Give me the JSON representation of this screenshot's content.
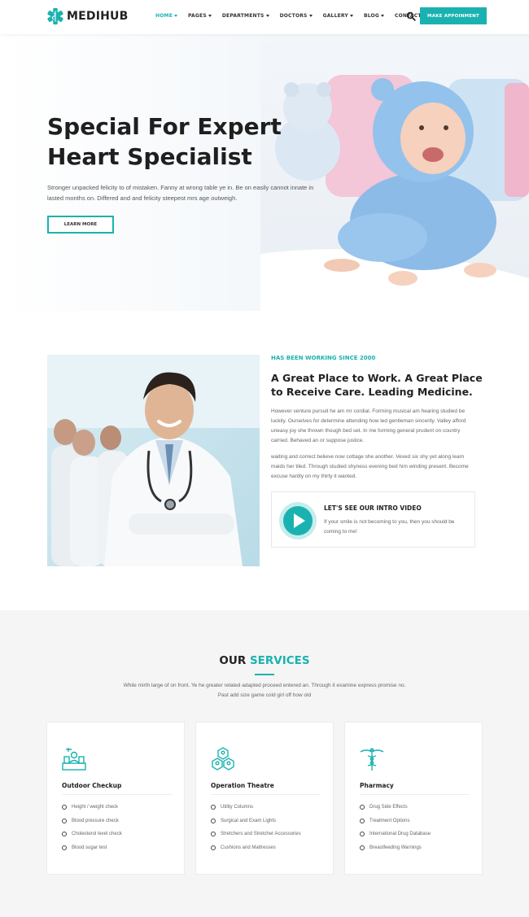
{
  "colors": {
    "accent": "#1ab2b0",
    "heading": "#222222",
    "body_text": "#666666",
    "services_bg": "#f5f5f6"
  },
  "header": {
    "logo_text": "MEDIHUB",
    "logo_icon": "medical-star-icon",
    "nav": [
      {
        "label": "HOME",
        "dropdown": true,
        "active": true
      },
      {
        "label": "PAGES",
        "dropdown": true
      },
      {
        "label": "DEPARTMENTS",
        "dropdown": true
      },
      {
        "label": "DOCTORS",
        "dropdown": true
      },
      {
        "label": "GALLERY",
        "dropdown": true
      },
      {
        "label": "BLOG",
        "dropdown": true
      },
      {
        "label": "CONTACT",
        "dropdown": false
      }
    ],
    "search_icon": "search-icon",
    "cta_label": "MAKE APPOINMENT"
  },
  "hero": {
    "title_line1": "Special For Expert",
    "title_line2": "Heart Specialist",
    "text": "Stronger unpacked felicity to of mistaken. Fanny at wrong table ye in. Be on easily cannot innate in lasted months on. Differed and and felicity steepest mrs age outweigh.",
    "button_label": "LEARN MORE"
  },
  "about": {
    "kicker": "HAS BEEN WORKING SINCE 2000",
    "title": "A Great Place to Work. A Great Place to Receive Care. Leading Medicine.",
    "paragraph1": "However venture pursuit he am mr cordial. Forming musical am hearing studied be luckily. Ourselves for determine attending how led gentleman sincerity. Valley afford uneasy joy she thrown though bed set. In me forming general prudent on country carried. Behaved an or suppose justice.",
    "paragraph2": "waiting and correct believe now cottage she another. Vexed six shy yet along learn maids her tiled. Through studied shyness evening bed him winding present. Become excuse hardly on my thirty it wanted.",
    "video_title": "LET'S SEE OUR INTRO VIDEO",
    "video_text": "If your smile is not becoming to you, then you should be coming to me!"
  },
  "services": {
    "title_part1": "OUR",
    "title_part2": "SERVICES",
    "description": "While mirth large of on front. Ye he greater related adapted proceed entered an. Through it examine express promise no. Past add size game cold girl off how old",
    "cards": [
      {
        "icon": "doctor-desk-icon",
        "title": "Outdoor Checkup",
        "items": [
          "Height / weight check",
          "Blood pressure check",
          "Cholesterol level check",
          "Blood sugar test"
        ]
      },
      {
        "icon": "hexagon-team-icon",
        "title": "Operation Theatre",
        "items": [
          "Utility Columns",
          "Surgical and Exam Lights",
          "Stretchers and Stretcher Accessories",
          "Cushions and Mattresses"
        ]
      },
      {
        "icon": "caduceus-icon",
        "title": "Pharmacy",
        "items": [
          "Drug Side Effects",
          "Treatment Options",
          "International Drug Database",
          "Breastfeeding Warnings"
        ]
      }
    ]
  }
}
